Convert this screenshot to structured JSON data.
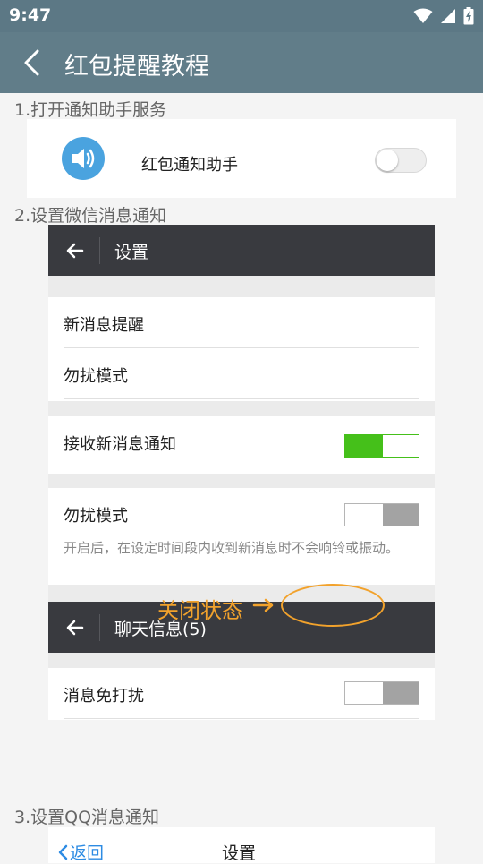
{
  "status": {
    "time": "9:47"
  },
  "app": {
    "title": "红包提醒教程"
  },
  "steps": {
    "s1": "1.打开通知助手服务",
    "s2": "2.设置微信消息通知",
    "s3": "3.设置QQ消息通知"
  },
  "card1": {
    "label": "红包通知助手",
    "toggle_state": "off"
  },
  "wechat": {
    "settings_title": "设置",
    "row_new_msg": "新消息提醒",
    "row_dnd": "勿扰模式",
    "row_receive": "接收新消息通知",
    "receive_state": "on",
    "dnd_title": "勿扰模式",
    "dnd_state": "off",
    "dnd_hint": "开启后，在设定时间段内收到新消息时不会响铃或振动。",
    "chat_title": "聊天信息(5)",
    "row_mute": "消息免打扰",
    "mute_state": "off"
  },
  "annotation": {
    "text": "关闭状态",
    "arrow": "→",
    "color": "#f2a22c"
  },
  "qq": {
    "back_label": "返回",
    "title": "设置"
  },
  "colors": {
    "statusbar": "#5c7885",
    "appbar": "#617d89",
    "wechat_bar": "#393a3f",
    "switch_on": "#45c01a",
    "speaker": "#4aa3df",
    "qq_link": "#2d8be3"
  }
}
